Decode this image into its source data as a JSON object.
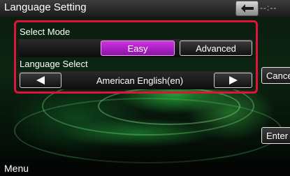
{
  "header": {
    "title": "Language Setting",
    "clock": "--:--"
  },
  "select_mode": {
    "label": "Select Mode",
    "options": [
      "Easy",
      "Advanced"
    ],
    "selected": "Easy"
  },
  "language_select": {
    "label": "Language Select",
    "value": "American English(en)"
  },
  "buttons": {
    "cancel": "Cancel",
    "enter": "Enter"
  },
  "footer": {
    "menu": "Menu"
  },
  "colors": {
    "highlight_frame": "#e0143a",
    "active_button": "#b020c8"
  }
}
